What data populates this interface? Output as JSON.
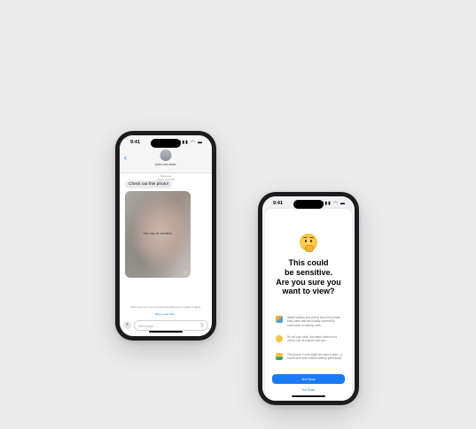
{
  "left_phone": {
    "status_time": "9:41",
    "status_icons": "▮▮▮ ◠ ▬",
    "back_icon": "chevron-left-icon",
    "contact_name": "jules.nos.straw",
    "conversation_service": "iMessage",
    "conversation_date": "Today 9:41 AM",
    "message_text": "Check out this photo!",
    "photo_caption": "This may be sensitive.",
    "photo_reveal_icon": "eye-icon",
    "footer_note": "Click to get help if you or a friend and preferences to please to adjust.",
    "footer_link": "Ways to Get Help...",
    "compose_placeholder": "iMessage",
    "compose_plus": "+",
    "compose_mic": "🎙"
  },
  "right_phone": {
    "status_time": "9:41",
    "status_icons": "▮▮▮ ◠ ▬",
    "emoji": "thinking-face-icon",
    "headline_line1": "This could",
    "headline_line2": "be sensitive.",
    "headline_line3": "Are you sure you",
    "headline_line4": "want to view?",
    "reasons": [
      {
        "icon": "body-parts-icon",
        "text": "Naked photos and videos show the private body parts that are usually covered by underwear or bathing suits."
      },
      {
        "icon": "face-icon",
        "text": "It's not your fault, but naked photos and videos can be used to hurt you."
      },
      {
        "icon": "person-shared-icon",
        "text": "The person in this might not want it seen—it could have been shared without permission."
      }
    ],
    "not_now_label": "Not Now",
    "im_sure_label": "I'm Sure"
  }
}
